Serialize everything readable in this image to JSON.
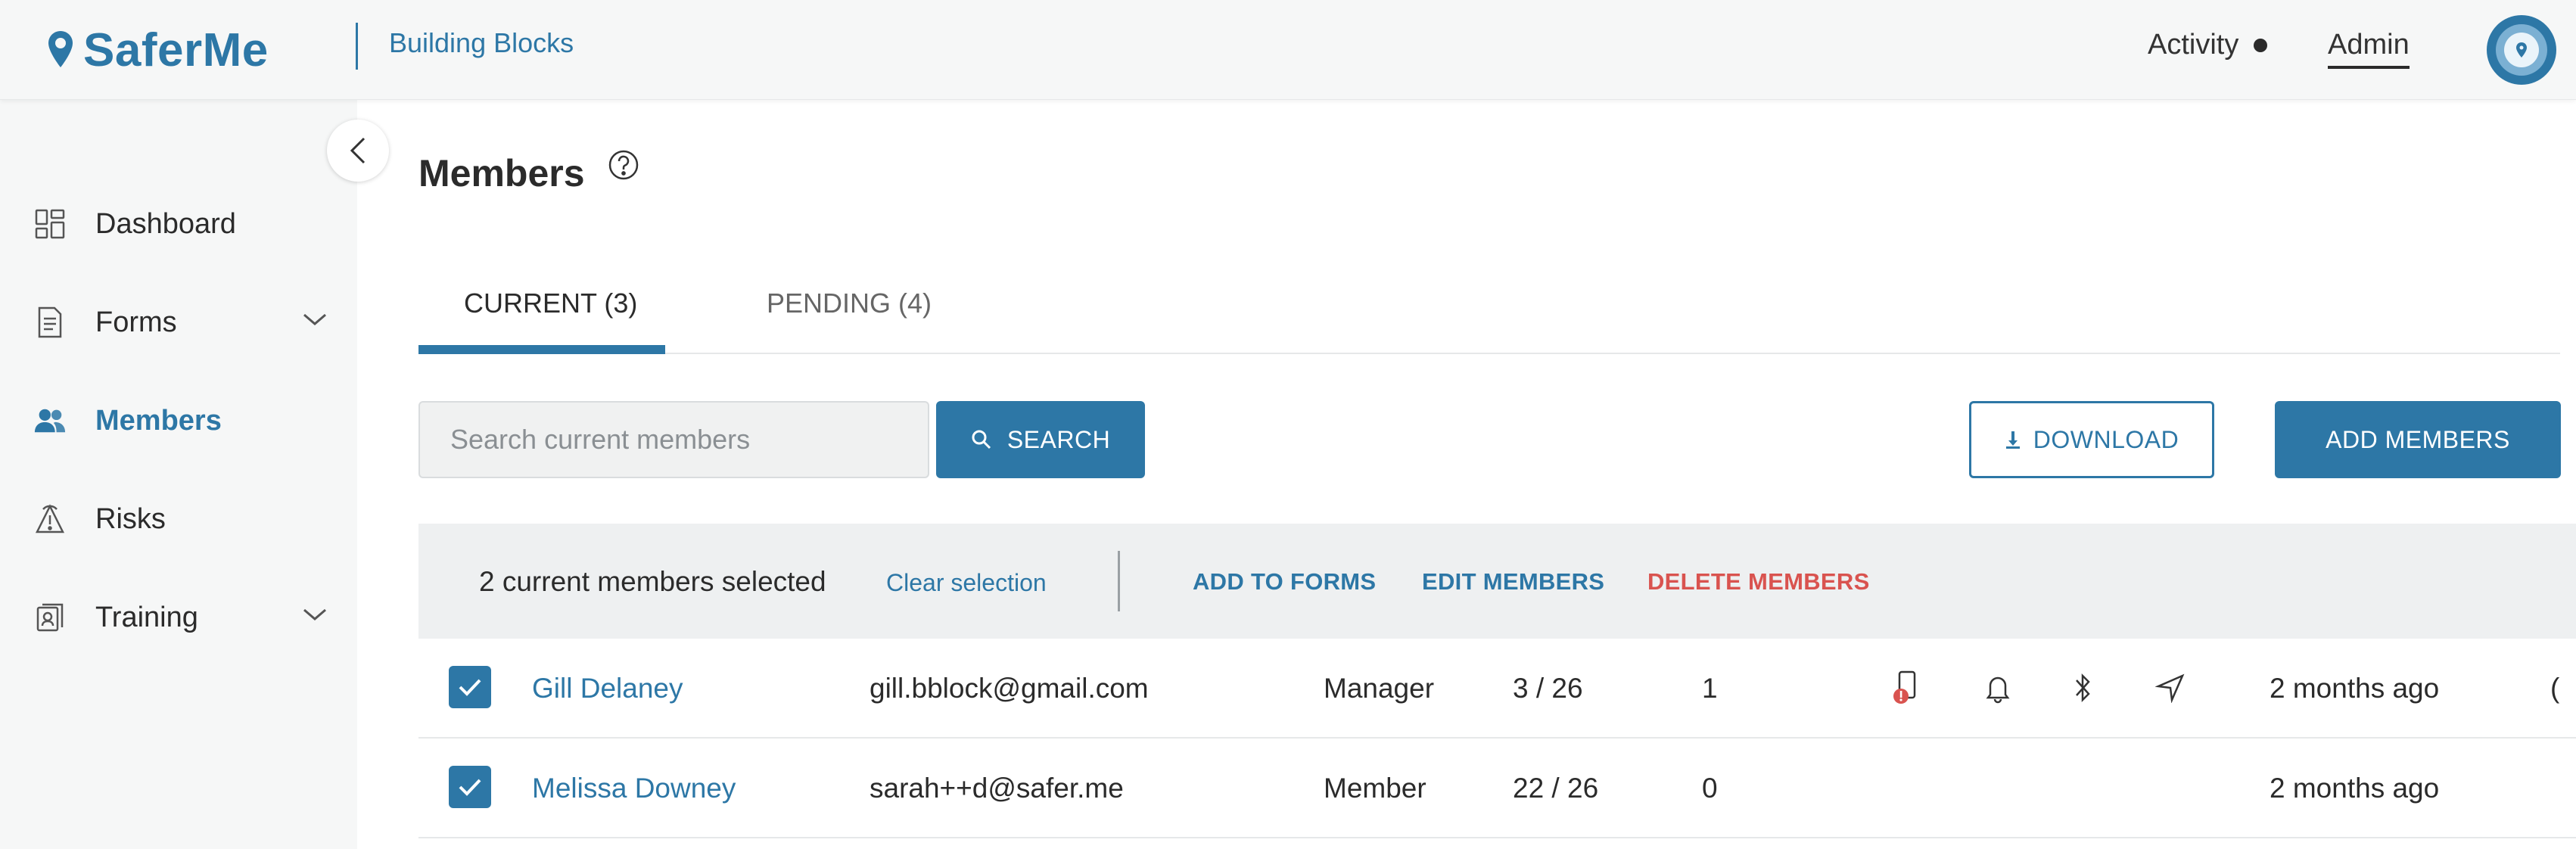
{
  "app": {
    "logo_text": "SaferMe",
    "org_name": "Building Blocks"
  },
  "header": {
    "activity_label": "Activity",
    "admin_label": "Admin"
  },
  "sidebar": {
    "items": [
      {
        "label": "Dashboard",
        "icon": "dashboard-icon"
      },
      {
        "label": "Forms",
        "icon": "forms-icon",
        "expandable": true
      },
      {
        "label": "Members",
        "icon": "members-icon",
        "active": true
      },
      {
        "label": "Risks",
        "icon": "risks-icon"
      },
      {
        "label": "Training",
        "icon": "training-icon",
        "expandable": true
      }
    ]
  },
  "page": {
    "title": "Members"
  },
  "tabs": [
    {
      "label": "CURRENT (3)",
      "active": true
    },
    {
      "label": "PENDING (4)",
      "active": false
    }
  ],
  "search": {
    "placeholder": "Search current members",
    "button_label": "SEARCH"
  },
  "actions": {
    "download_label": "DOWNLOAD",
    "add_members_label": "ADD MEMBERS"
  },
  "selection": {
    "count_text": "2 current members selected",
    "clear_label": "Clear selection",
    "add_to_forms_label": "ADD TO FORMS",
    "edit_label": "EDIT MEMBERS",
    "delete_label": "DELETE MEMBERS"
  },
  "members": [
    {
      "name": "Gill Delaney",
      "email": "gill.bblock@gmail.com",
      "role": "Manager",
      "forms": "3 / 26",
      "count": "1",
      "last_active": "2 months ago",
      "more": "(",
      "checked": true
    },
    {
      "name": "Melissa Downey",
      "email": "sarah++d@safer.me",
      "role": "Member",
      "forms": "22 / 26",
      "count": "0",
      "last_active": "2 months ago",
      "checked": true
    }
  ],
  "colors": {
    "brand": "#2d77a6",
    "danger": "#d9534f",
    "sidebar_bg": "#f6f7f7"
  }
}
